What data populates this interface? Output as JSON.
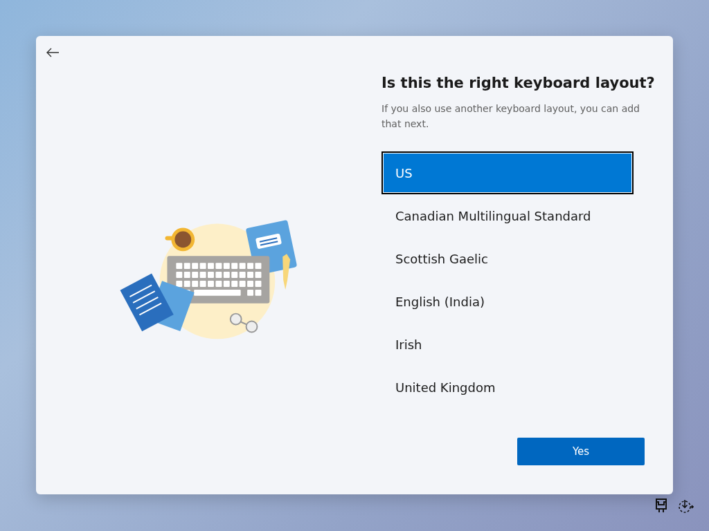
{
  "title": "Is this the right keyboard layout?",
  "subtitle": "If you also use another keyboard layout, you can add that next.",
  "layouts": [
    {
      "label": "US",
      "selected": true
    },
    {
      "label": "Canadian Multilingual Standard",
      "selected": false
    },
    {
      "label": "Scottish Gaelic",
      "selected": false
    },
    {
      "label": "English (India)",
      "selected": false
    },
    {
      "label": "Irish",
      "selected": false
    },
    {
      "label": "United Kingdom",
      "selected": false
    }
  ],
  "button": "Yes"
}
